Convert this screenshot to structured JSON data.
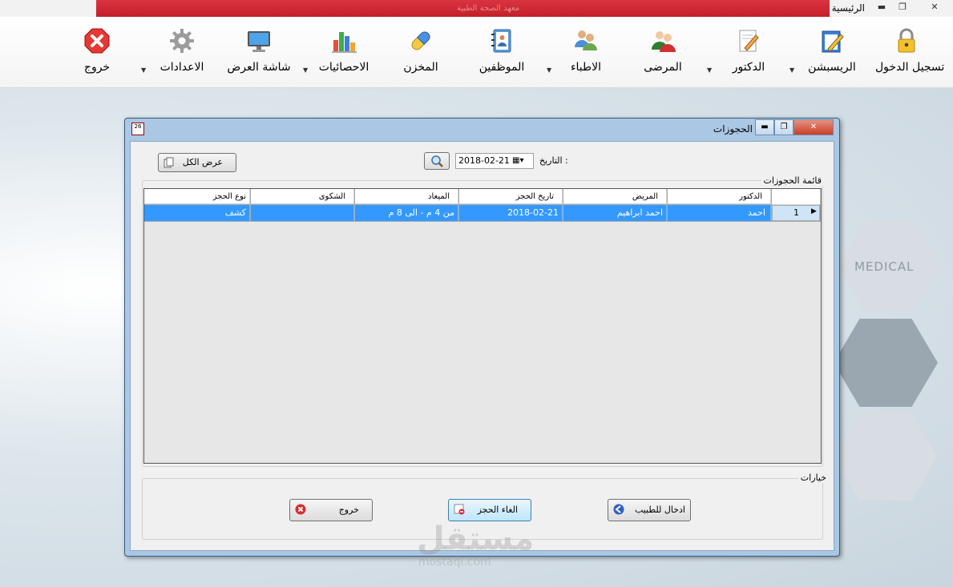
{
  "window": {
    "title": "الرئيسية",
    "banner_text": "معهد الصحة الطبية"
  },
  "toolbar": {
    "items": [
      {
        "label": "تسجيل الدخول",
        "icon": "padlock-icon"
      },
      {
        "label": "الريسبشن",
        "icon": "notepad-pencil-icon"
      },
      {
        "label": "الدكتور",
        "icon": "document-pencil-icon"
      },
      {
        "label": "المرضى",
        "icon": "patients-icon"
      },
      {
        "label": "الاطباء",
        "icon": "doctors-icon"
      },
      {
        "label": "الموظفين",
        "icon": "address-book-icon"
      },
      {
        "label": "المخزن",
        "icon": "pill-icon"
      },
      {
        "label": "الاحصائيات",
        "icon": "bar-chart-icon"
      },
      {
        "label": "شاشة العرض",
        "icon": "monitor-icon"
      },
      {
        "label": "الاعدادات",
        "icon": "gear-icon"
      },
      {
        "label": "خروج",
        "icon": "red-x-icon"
      }
    ]
  },
  "background": {
    "medical_text": "MEDICAL",
    "watermark": "مستقل",
    "watermark_url": "mostaql.com"
  },
  "dialog": {
    "title": "الحجوزات",
    "icon_text": "26",
    "show_all_button": "عرض الكل",
    "date_label": "التاريخ :",
    "date_value": "2018-02-21",
    "list_group_label": "قائمة الحجوزات",
    "options_group_label": "خيارات",
    "columns": [
      "الدكتور",
      "المريض",
      "تاريخ الحجز",
      "الميعاد",
      "الشكوى",
      "نوع الحجز"
    ],
    "rows": [
      {
        "num": "1",
        "doctor": "احمد",
        "patient": "احمد ابراهيم",
        "date": "2018-02-21",
        "time": "من 4 م - الى 8 م",
        "complaint": "",
        "type": "كشف"
      }
    ],
    "buttons": {
      "enter_doctor": "ادخال للطبيب",
      "cancel_booking": "الغاء الحجز",
      "exit": "خروج"
    },
    "colors": {
      "selection": "#3399ff"
    }
  }
}
